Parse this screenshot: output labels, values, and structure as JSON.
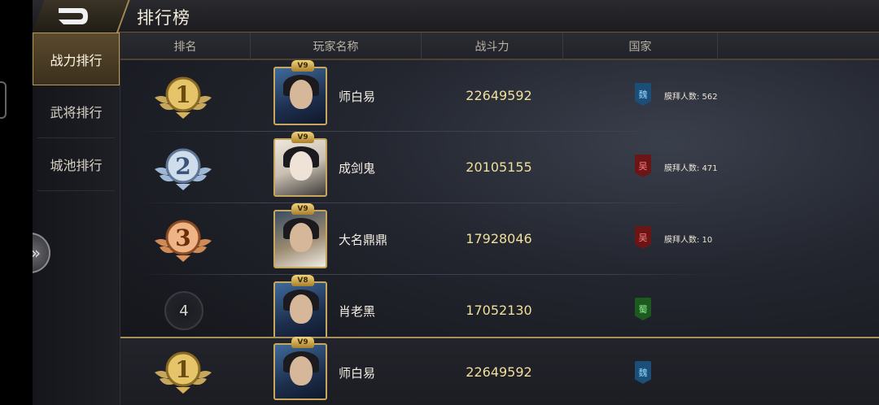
{
  "header": {
    "title": "排行榜"
  },
  "sidebar": {
    "items": [
      {
        "label": "战力排行",
        "active": true
      },
      {
        "label": "武将排行",
        "active": false
      },
      {
        "label": "城池排行",
        "active": false
      }
    ]
  },
  "columns": [
    "排名",
    "玩家名称",
    "战斗力",
    "国家"
  ],
  "rows": [
    {
      "rank": "1",
      "vip": "V9",
      "name": "师白易",
      "power": "22649592",
      "nation": "魏",
      "worship": "膜拜人数: 562"
    },
    {
      "rank": "2",
      "vip": "V9",
      "name": "成剑鬼",
      "power": "20105155",
      "nation": "吴",
      "worship": "膜拜人数: 471"
    },
    {
      "rank": "3",
      "vip": "V9",
      "name": "大名鼎鼎",
      "power": "17928046",
      "nation": "吴",
      "worship": "膜拜人数: 10"
    },
    {
      "rank": "4",
      "vip": "V8",
      "name": "肖老黑",
      "power": "17052130",
      "nation": "蜀",
      "worship": ""
    }
  ],
  "my_rank": {
    "rank": "1",
    "vip": "V9",
    "name": "师白易",
    "power": "22649592",
    "nation": "魏"
  },
  "colors": {
    "gold": "#c7a65d",
    "silver": "#9fb8d6",
    "bronze": "#d08a55",
    "wei": "#1c4f78",
    "wu": "#6b1517",
    "shu": "#1c5a20"
  }
}
